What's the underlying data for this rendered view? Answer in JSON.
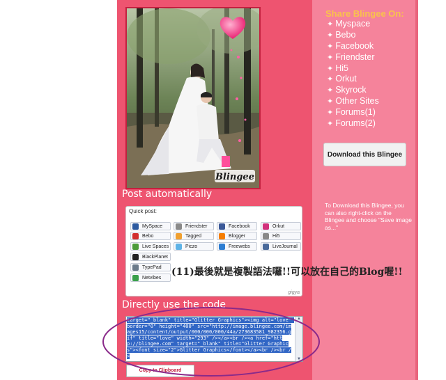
{
  "photo": {
    "watermark": "Blingee"
  },
  "post_automatically": {
    "title": "Post automatically",
    "widget_title": "Quick post:",
    "branding": "gigya",
    "buttons": [
      {
        "label": "MySpace",
        "color": "#2c5aa0"
      },
      {
        "label": "Friendster",
        "color": "#8a8a8a"
      },
      {
        "label": "Facebook",
        "color": "#3b5998"
      },
      {
        "label": "Orkut",
        "color": "#d2317c"
      },
      {
        "label": "Bebo",
        "color": "#d22e2e"
      },
      {
        "label": "Tagged",
        "color": "#f0a030"
      },
      {
        "label": "Blogger",
        "color": "#f57d00"
      },
      {
        "label": "Hi5",
        "color": "#888888"
      },
      {
        "label": "Live Spaces",
        "color": "#4c9c3a"
      },
      {
        "label": "Piczo",
        "color": "#5fb3e6"
      },
      {
        "label": "Freewebs",
        "color": "#2d7dd2"
      },
      {
        "label": "LiveJournal",
        "color": "#4a6a9a"
      },
      {
        "label": "BlackPlanet",
        "color": "#222222"
      },
      {
        "label": "TypePad",
        "color": "#6a7a8a"
      },
      {
        "label": "Netvibes",
        "color": "#3aa04a"
      }
    ]
  },
  "direct_code": {
    "title": "Directly use the code",
    "code": "target=\"_blank\" title=\"Glitter Graphics\"><img alt=\"love\" border=\"0\" height=\"400\" src=\"http://image.blingee.com/images15/content/output/000/000/000/44a/273683581_982356.gif\" title=\"love\" width=\"293\" /></a><br /><a href=\"http://blingee.com\" target=\"_blank\" title=\"Glitter Graphics\"><font size=\"2\">Glitter Graphics</font></a><br /><br />",
    "copy_label": "Copy to Clipboard"
  },
  "share": {
    "title": "Share Blingee On:",
    "items": [
      "Myspace",
      "Bebo",
      "Facebook",
      "Friendster",
      "Hi5",
      "Orkut",
      "Skyrock",
      "Other Sites",
      "Forums(1)",
      "Forums(2)"
    ]
  },
  "download": {
    "button_label": "Download this Blingee",
    "help_text": "To Download this Blingee, you can also right-click on the Blingee and choose \"Save image as...\""
  },
  "annotation": {
    "text": "(11)最後就是複製語法囉!!可以放在自己的Blog喔!!"
  },
  "colors": {
    "page_bg": "#ffffff",
    "left_col": "#ee5470",
    "right_col": "#f5839b",
    "share_title": "#f9c24c",
    "annotation_ellipse": "#8a2a8a"
  }
}
